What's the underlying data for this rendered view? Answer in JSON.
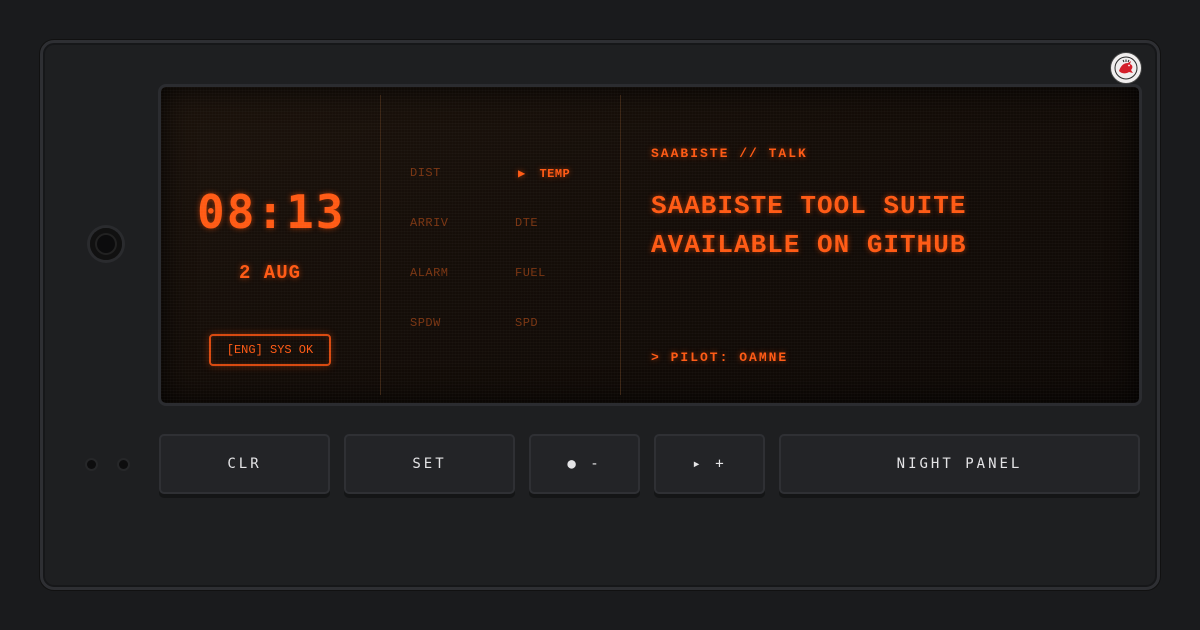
{
  "brand": {
    "logo_icon": "dragon-logo-icon"
  },
  "display": {
    "clock": "08:13",
    "date": "2 AUG",
    "status_button": "[ENG] SYS OK",
    "menu": {
      "col1": [
        "DIST",
        "ARRIV",
        "ALARM",
        "SPDW"
      ],
      "col2": [
        "DTE",
        "FUEL",
        "SPD"
      ],
      "active": "TEMP",
      "active_marker": "▶"
    },
    "channel_title": "SAABISTE // TALK",
    "message_line1": "SAABISTE TOOL SUITE",
    "message_line2": "AVAILABLE ON GITHUB",
    "pilot": "> PILOT: OAMNE"
  },
  "keys": {
    "clr": "CLR",
    "set": "SET",
    "minus": "● -",
    "plus": "▸ +",
    "night": "NIGHT PANEL"
  },
  "colors": {
    "accent": "#ff5a14",
    "dim": "#7a3512",
    "panel": "#1e1f21"
  }
}
